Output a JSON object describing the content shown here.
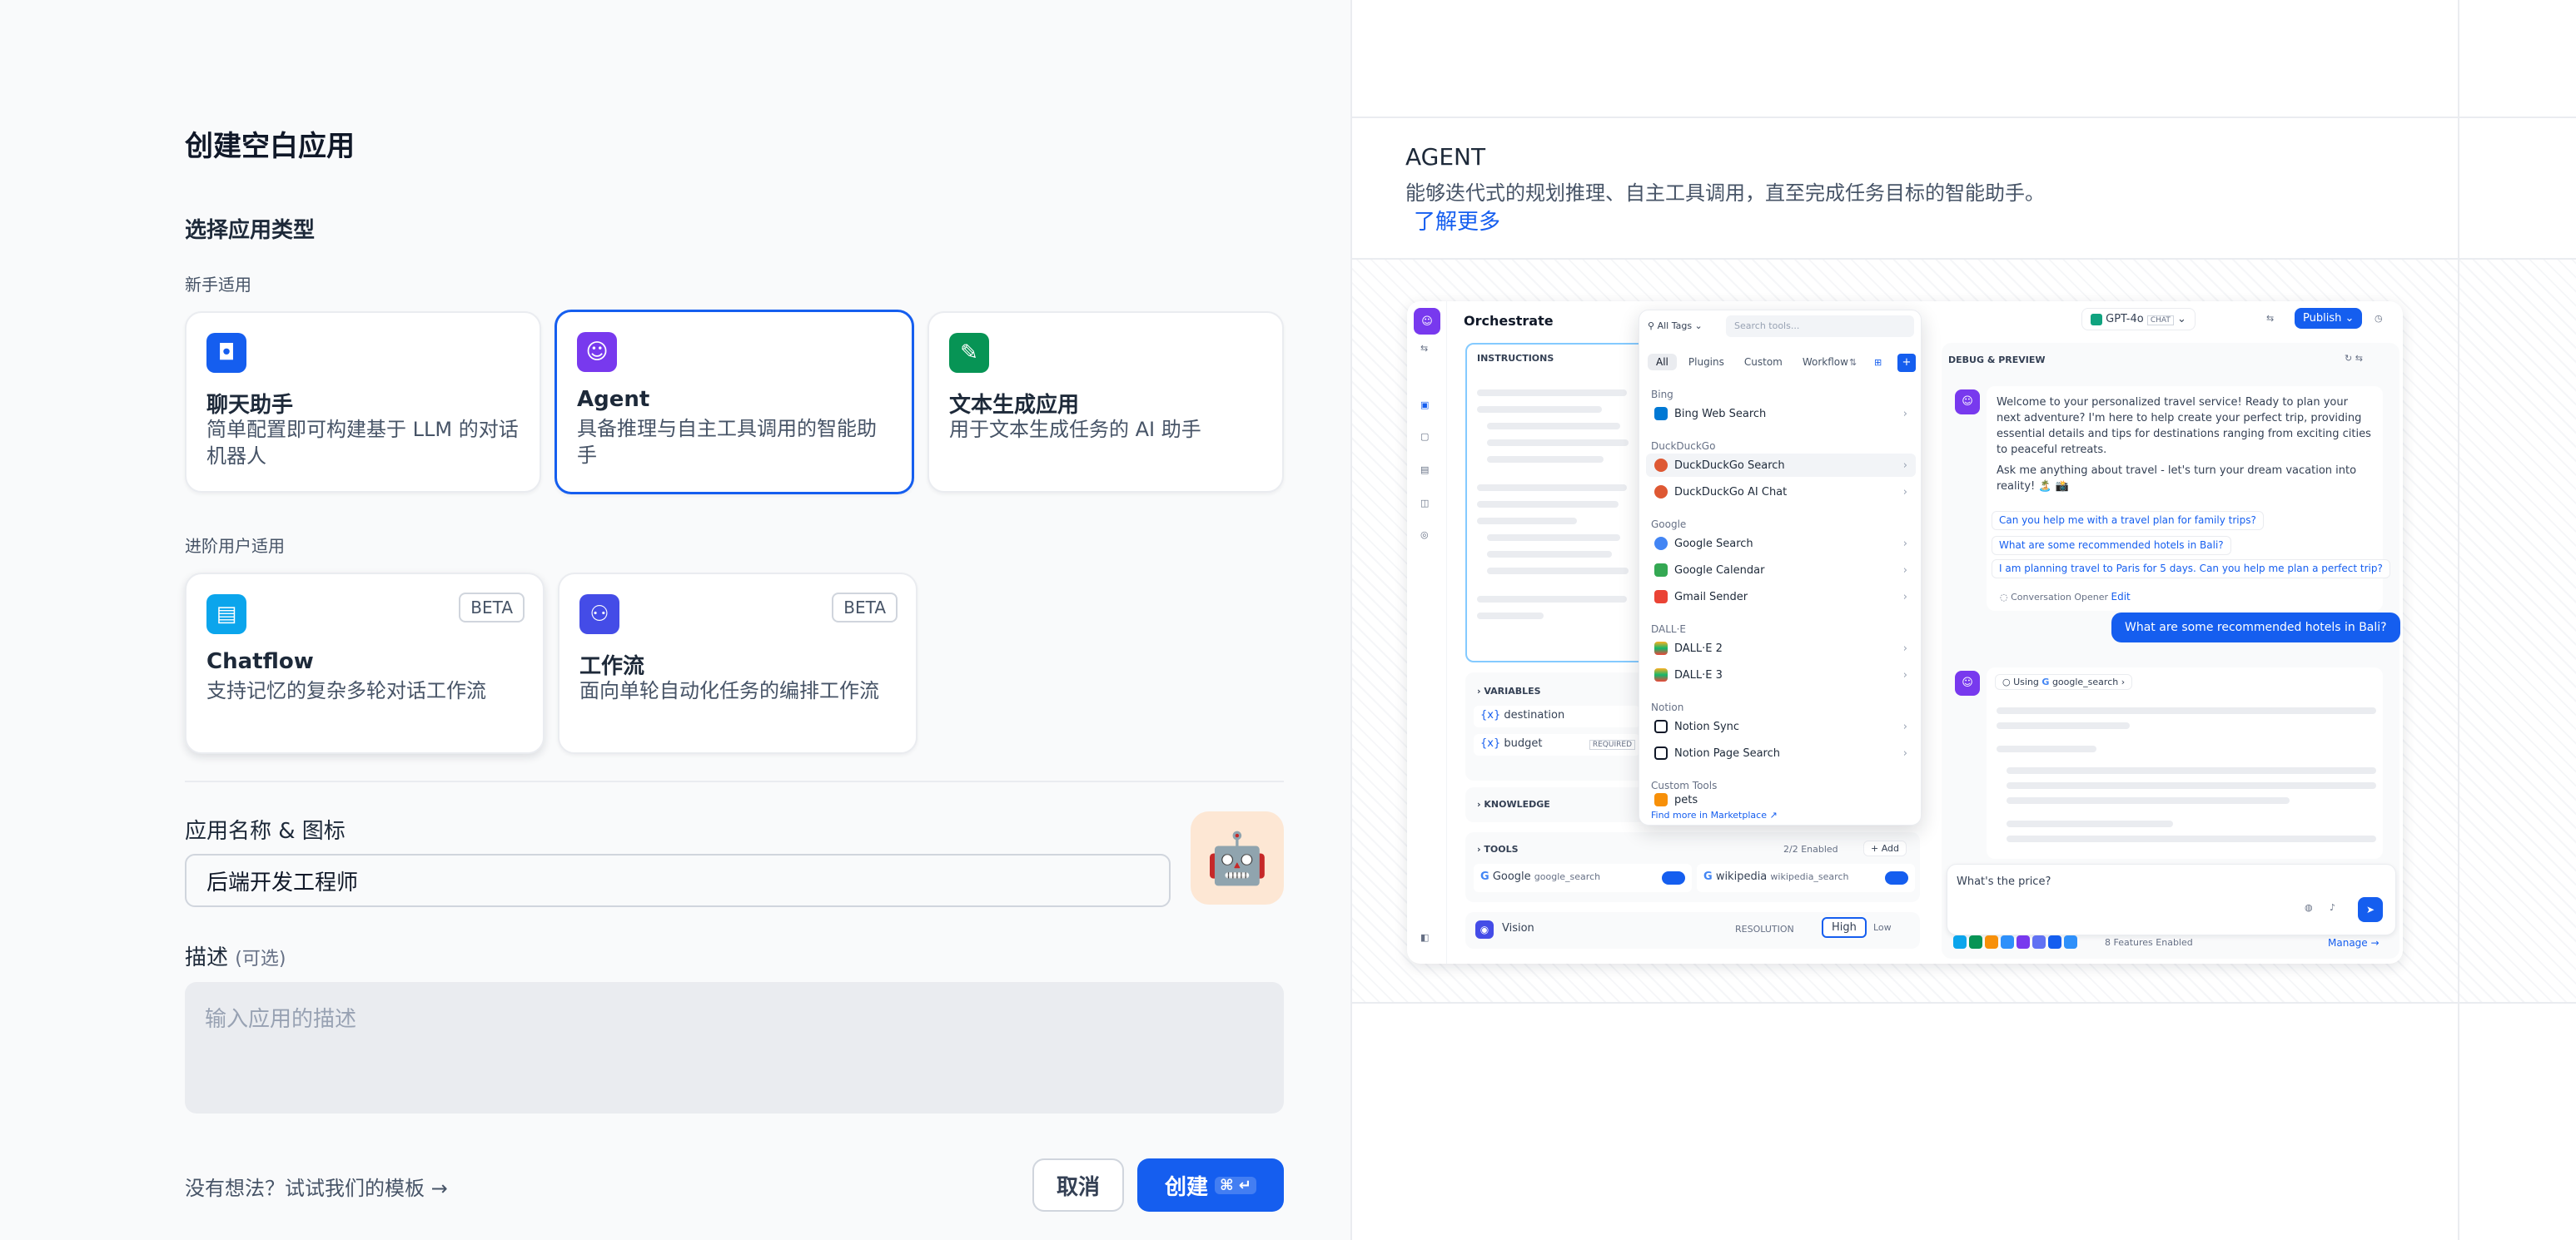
{
  "left": {
    "title": "创建空白应用",
    "choose_type": "选择应用类型",
    "beginner": "新手适用",
    "advanced": "进阶用户适用",
    "cards": [
      {
        "title": "聊天助手",
        "desc": "简单配置即可构建基于 LLM 的对话机器人",
        "icon": "chat-bot-icon",
        "color": "#155eef"
      },
      {
        "title": "Agent",
        "desc": "具备推理与自主工具调用的智能助手",
        "icon": "agent-icon",
        "color": "#7839ee"
      },
      {
        "title": "文本生成应用",
        "desc": "用于文本生成任务的 AI 助手",
        "icon": "text-gen-icon",
        "color": "#079455"
      },
      {
        "title": "Chatflow",
        "desc": "支持记忆的复杂多轮对话工作流",
        "icon": "chatflow-icon",
        "color": "#0ba5ec",
        "badge": "BETA"
      },
      {
        "title": "工作流",
        "desc": "面向单轮自动化任务的编排工作流",
        "icon": "workflow-icon",
        "color": "#444ce7",
        "badge": "BETA"
      }
    ],
    "name_label": "应用名称 & 图标",
    "name_value": "后端开发工程师",
    "desc_label": "描述",
    "desc_optional": "(可选)",
    "desc_placeholder": "输入应用的描述",
    "template_link": "没有想法？试试我们的模板",
    "cancel": "取消",
    "create": "创建",
    "shortcut": "⌘ ↵"
  },
  "right": {
    "title": "AGENT",
    "desc": "能够迭代式的规划推理、自主工具调用，直至完成任务目标的智能助手。",
    "learn_more": "了解更多",
    "preview": {
      "orchestrate": "Orchestrate",
      "instructions": "INSTRUCTIONS",
      "model": "GPT-4o",
      "model_tag": "CHAT",
      "publish": "Publish",
      "variables": "VARIABLES",
      "var1": "destination",
      "var2": "budget",
      "required": "REQUIRED",
      "knowledge": "KNOWLEDGE",
      "tools": "TOOLS",
      "tools_enabled": "2/2 Enabled",
      "add": "Add",
      "tool1": "Google",
      "tool1_id": "google_search",
      "tool2": "wikipedia",
      "tool2_id": "wikipedia_search",
      "vision": "Vision",
      "resolution": "RESOLUTION",
      "high": "High",
      "low": "Low",
      "debug": "DEBUG & PREVIEW",
      "welcome": "Welcome to your personalized travel service! Ready to plan your next adventure? I'm here to help create your perfect trip, providing essential details and tips for destinations ranging from exciting cities to peaceful retreats.",
      "ask": "Ask me anything about travel - let's turn your dream vacation into reality! 🏝️ 📸",
      "q1": "Can you help me with a travel plan for family trips?",
      "q2": "What are some recommended hotels in Bali?",
      "q3": "I am planning travel to Paris for 5 days. Can you help me plan a perfect trip?",
      "opener": "Conversation Opener",
      "edit": "Edit",
      "user_msg": "What are some recommended hotels in Bali?",
      "using": "Using",
      "using_tool": "google_search",
      "input": "What's the price?",
      "features": "8 Features Enabled",
      "manage": "Manage",
      "dropdown": {
        "tags": "All Tags",
        "search": "Search tools...",
        "tabs": [
          "All",
          "Plugins",
          "Custom",
          "Workflow"
        ],
        "groups": [
          {
            "name": "Bing",
            "items": [
              "Bing Web Search"
            ]
          },
          {
            "name": "DuckDuckGo",
            "items": [
              "DuckDuckGo Search",
              "DuckDuckGo AI Chat"
            ]
          },
          {
            "name": "Google",
            "items": [
              "Google Search",
              "Google Calendar",
              "Gmail Sender"
            ]
          },
          {
            "name": "DALL·E",
            "items": [
              "DALL·E 2",
              "DALL·E 3"
            ]
          },
          {
            "name": "Notion",
            "items": [
              "Notion Sync",
              "Notion Page Search"
            ]
          },
          {
            "name": "Custom Tools",
            "items": [
              "pets"
            ]
          }
        ],
        "find_more": "Find more in",
        "marketplace": "Marketplace ↗"
      }
    }
  }
}
